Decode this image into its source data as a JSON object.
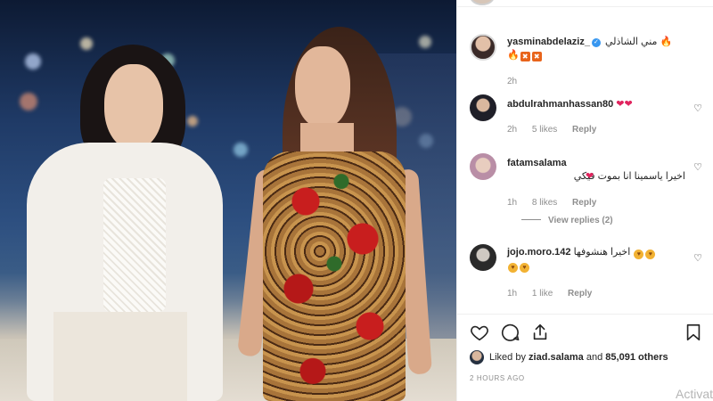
{
  "post": {
    "caption": {
      "username": "yasminabdelaziz_",
      "text": "مني الشاذلي",
      "time": "2h"
    },
    "comments": [
      {
        "username": "abdulrahmanhassan80",
        "text": "",
        "emojis": [
          "red-heart",
          "red-heart"
        ],
        "time": "2h",
        "likes": "5 likes",
        "reply": "Reply"
      },
      {
        "username": "fatamsalama",
        "text": "اخيرا ياسمينا انا بموت فيكي",
        "emojis": [
          "red-heart"
        ],
        "time": "1h",
        "likes": "8 likes",
        "reply": "Reply",
        "view_replies": "View replies (2)"
      },
      {
        "username": "jojo.moro.142",
        "text": "اخيرا هنشوفها",
        "emojis": [
          "heart-eyes",
          "heart-eyes",
          "heart-eyes",
          "heart-eyes"
        ],
        "time": "1h",
        "likes": "1 like",
        "reply": "Reply"
      }
    ],
    "likes": {
      "prefix": "Liked by",
      "user": "ziad.salama",
      "connector": "and",
      "count": "85,091 others"
    },
    "posted": "2 HOURS AGO",
    "action_icons": [
      "heart-icon",
      "comment-icon",
      "share-icon",
      "bookmark-icon"
    ]
  },
  "watermark": "Activat",
  "colors": {
    "username": "#262626",
    "meta": "#8e8e8e",
    "heart": "#e0245e",
    "verified": "#3897f0"
  }
}
